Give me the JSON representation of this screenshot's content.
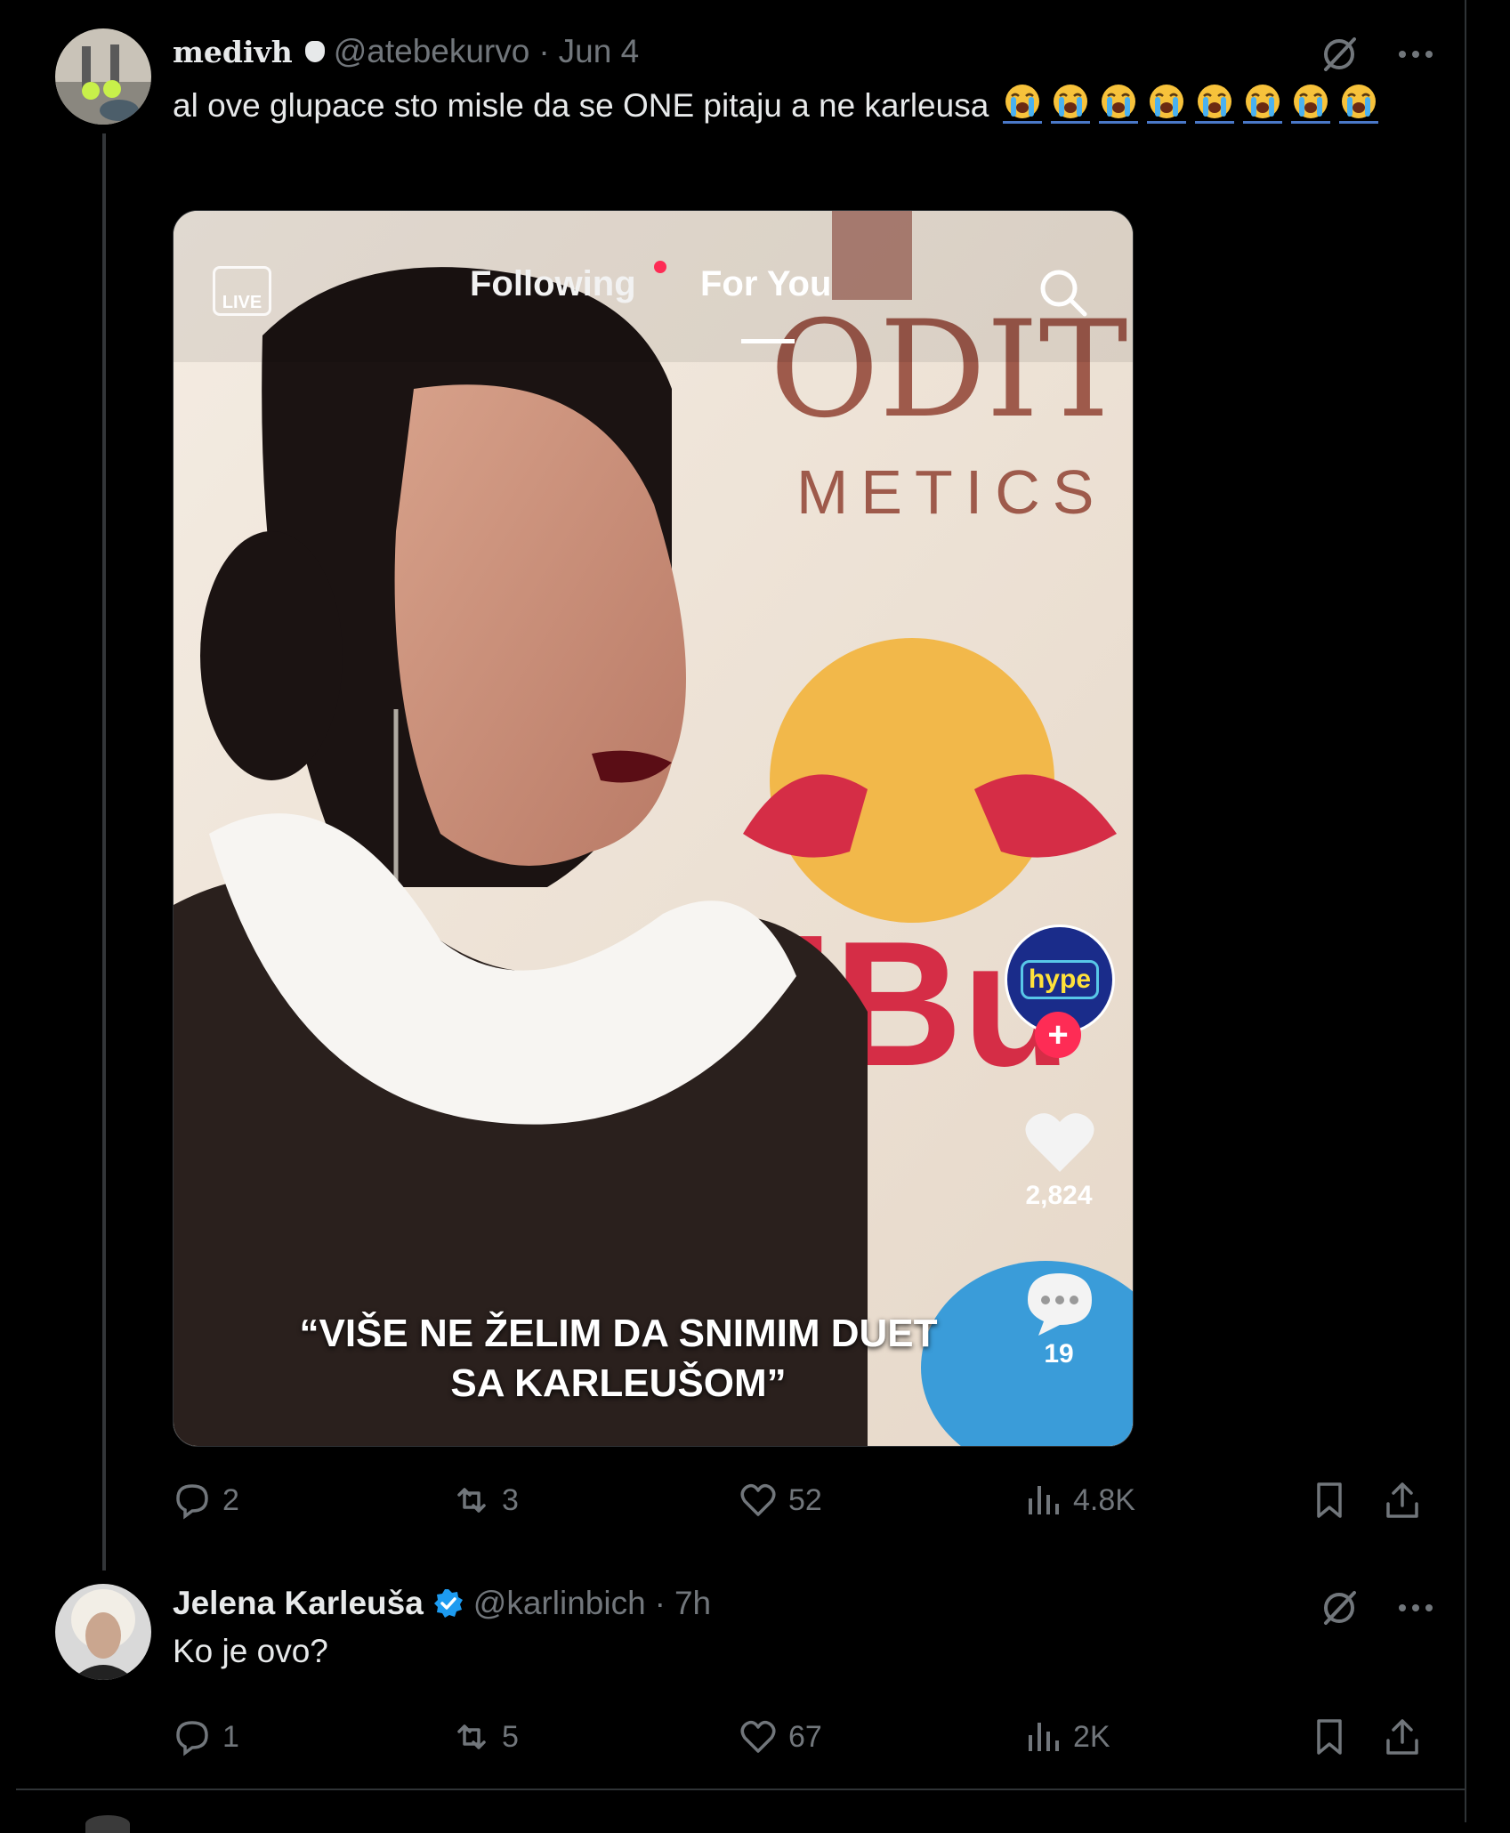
{
  "post": {
    "display_name": "medivh",
    "handle": "@atebekurvo",
    "separator": "·",
    "time": "Jun 4",
    "text": "al ove glupace sto misle da se ONE pitaju a ne karleusa",
    "emoji_count": 8,
    "media": {
      "tab_live": "LIVE",
      "tab_following": "Following",
      "tab_foryou": "For You",
      "brand_text_1": "ODIT",
      "brand_text_2": "METICS",
      "brand_text_3": "dBu",
      "caption_line1": "“VIŠE NE ŽELIM DA SNIMIM DUET",
      "caption_line2": "SA KARLEUŠOM”",
      "creator_badge": "hype",
      "likes": "2,824",
      "comments": "19"
    },
    "stats": {
      "replies": "2",
      "reposts": "3",
      "likes": "52",
      "views": "4.8K"
    }
  },
  "reply": {
    "display_name": "Jelena Karleuša",
    "handle": "@karlinbich",
    "separator": "·",
    "time": "7h",
    "text": "Ko je ovo?",
    "stats": {
      "replies": "1",
      "reposts": "5",
      "likes": "67",
      "views": "2K"
    }
  },
  "colors": {
    "background": "#000000",
    "text": "#e7e9ea",
    "muted": "#71767b",
    "verified": "#1d9bf0",
    "border": "#2f3336"
  }
}
